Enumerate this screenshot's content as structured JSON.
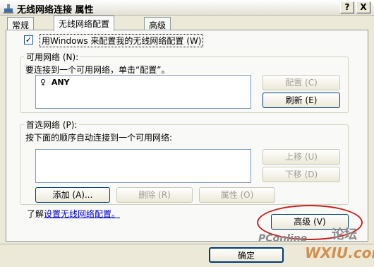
{
  "window": {
    "title": "无线网络连接 属性",
    "help_button": "?",
    "close_button": "X"
  },
  "tabs": [
    {
      "label": "常规"
    },
    {
      "label": "无线网络配置"
    },
    {
      "label": "高级"
    }
  ],
  "config": {
    "use_windows_label": "用Windows 来配置我的无线网络配置 (W)",
    "use_windows_checked": "✓"
  },
  "available": {
    "legend": "可用网络 (N):",
    "instruction": "要连接到一个可用网络，单击“配置”。",
    "networks": [
      {
        "name": "ANY"
      }
    ],
    "configure_button": "配置 (C)",
    "refresh_button": "刷新 (E)"
  },
  "preferred": {
    "legend": "首选网络 (P):",
    "instruction": "按下面的顺序自动连接到一个可用网络:",
    "move_up_button": "上移 (U)",
    "move_down_button": "下移 (D)",
    "add_button": "添加 (A)...",
    "delete_button": "删除 (R)",
    "properties_button": "属性 (O)"
  },
  "learn": {
    "prefix": "了解",
    "link": "设置无线网络配置。"
  },
  "advanced_button": "高级 (V)",
  "ok_button": "确定",
  "watermarks": {
    "pconline": "PConline",
    "forum": "论坛",
    "wxiu": "WXIU.com"
  }
}
